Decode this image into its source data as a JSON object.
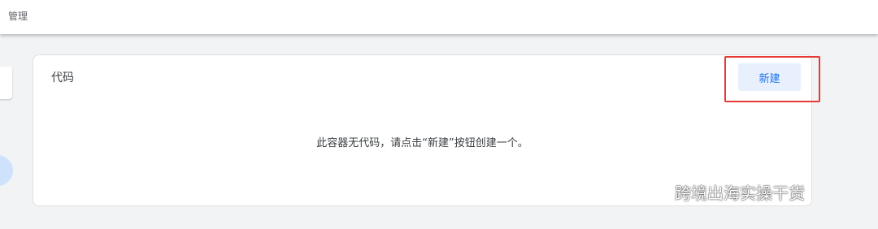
{
  "header": {
    "title": "管理"
  },
  "card": {
    "title": "代码",
    "new_button_label": "新建",
    "empty_message": "此容器无代码，请点击“新建”按钮创建一个。"
  },
  "watermark": {
    "icon": "wechat-icon",
    "text": "跨境出海实操干货"
  },
  "colors": {
    "page_background": "#f1f3f4",
    "accent": "#1a73e8",
    "button_background": "#e8f0fe",
    "highlight": "#e53935"
  }
}
